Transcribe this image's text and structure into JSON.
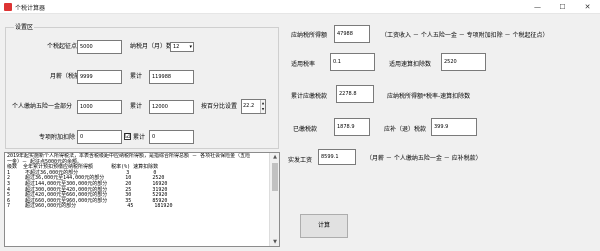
{
  "window": {
    "title": "个税计算器",
    "minimize": "—",
    "maximize": "☐",
    "close": "✕"
  },
  "settings": {
    "group_title": "设置区",
    "tax_threshold_label": "个税起征点",
    "tax_threshold_value": "5000",
    "tax_month_label": "纳税月（月）数",
    "tax_month_value": "12",
    "monthly_salary_label": "月薪（税前）",
    "monthly_salary_value": "9999",
    "cumulative_label_1": "累计",
    "cumulative_value_1": "119988",
    "insurance_label": "个人缴纳五险一金部分",
    "insurance_value": "1000",
    "cumulative_label_2": "累计",
    "cumulative_value_2": "12000",
    "percent_setting_label": "按百分比设置",
    "percent_setting_value": "22.2",
    "special_deduction_label": "专项附加扣除",
    "special_deduction_value": "0",
    "cumulative_label_3": "累计",
    "cumulative_checked": "☑",
    "cumulative_value_3": "0"
  },
  "results": {
    "taxable_income_label": "应纳税所得额",
    "taxable_income_value": "47988",
    "taxable_income_formula": "（工资收入 － 个人五险一金 － 专项附加扣除 － 个税起征点）",
    "tax_rate_label": "适用税率",
    "tax_rate_value": "0.1",
    "quick_deduction_label": "适用速算扣除数",
    "quick_deduction_value": "2520",
    "cumulative_tax_label": "累计应缴税款",
    "cumulative_tax_value": "2278.8",
    "cumulative_tax_formula": "应纳税所得额*税率-速算扣除数",
    "paid_tax_label": "已缴税款",
    "paid_tax_value": "1878.9",
    "due_tax_label": "应补（退）税款",
    "due_tax_value": "399.9",
    "actual_salary_label": "实发工资",
    "actual_salary_value": "8599.1",
    "actual_salary_formula": "（月薪 － 个人缴纳五险一金 － 应补税款）",
    "calculate_button": "计算"
  },
  "info_text": [
    "2019年起实施新个人所得税法，本表含税级距中应纳税所得额，是指综合所得总额 － 各项社会保险金（五险",
    "一金）－ 起征点5000元的余额。",
    "级数  全年累计预扣预缴应纳税所得额      税率(%) 速算扣除数",
    "1     不超过36,000元的部分                3        0",
    "2     超过36,000元至144,000元的部分       10       2520",
    "3     超过144,000元至300,000元的部分      20       16920",
    "4     超过300,000元至420,000元的部分      25       31920",
    "5     超过420,000元至660,000元的部分      30       52920",
    "6     超过660,000元至960,000元的部分      35       85920",
    "7     超过960,000元的部分                 45       181920"
  ],
  "scrollbar": {
    "up": "▲",
    "down": "▼"
  }
}
